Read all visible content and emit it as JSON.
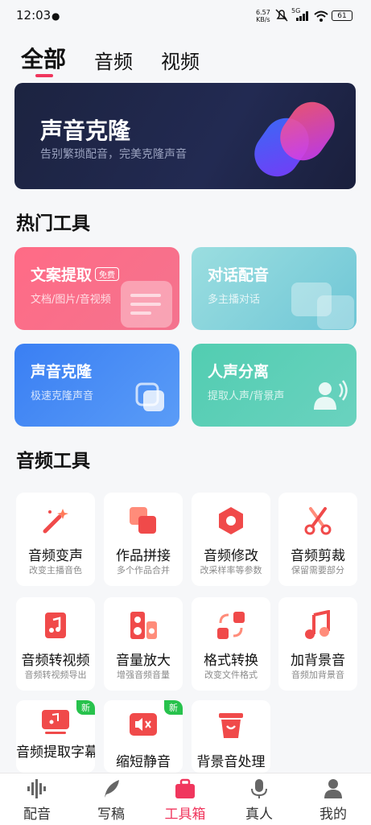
{
  "status_bar": {
    "time": "12:03",
    "net_rate_value": "6.57",
    "net_rate_unit": "KB/s",
    "network": "5G",
    "battery": "61"
  },
  "tabs": [
    {
      "label": "全部",
      "active": true
    },
    {
      "label": "音频",
      "active": false
    },
    {
      "label": "视频",
      "active": false
    }
  ],
  "banner": {
    "title": "声音克隆",
    "subtitle": "告别繁琐配音，完美克隆声音"
  },
  "hot_tools": {
    "title": "热门工具",
    "items": [
      {
        "title": "文案提取",
        "badge": "免费",
        "subtitle": "文档/图片/音视频",
        "color": "#f8607f"
      },
      {
        "title": "对话配音",
        "subtitle": "多主播对话",
        "color": "#7fd3d8"
      },
      {
        "title": "声音克隆",
        "subtitle": "极速克隆声音",
        "color": "#3f86f2"
      },
      {
        "title": "人声分离",
        "subtitle": "提取人声/背景声",
        "color": "#4ec8b0"
      }
    ]
  },
  "audio_tools": {
    "title": "音频工具",
    "items": [
      {
        "label": "音频变声",
        "sub": "改变主播音色",
        "icon": "magic-wand-icon"
      },
      {
        "label": "作品拼接",
        "sub": "多个作品合并",
        "icon": "merge-icon"
      },
      {
        "label": "音频修改",
        "sub": "改采样率等参数",
        "icon": "settings-hex-icon"
      },
      {
        "label": "音频剪裁",
        "sub": "保留需要部分",
        "icon": "scissors-icon"
      },
      {
        "label": "音频转视频",
        "sub": "音频转视频导出",
        "icon": "music-file-icon"
      },
      {
        "label": "音量放大",
        "sub": "增强音频音量",
        "icon": "speaker-icon"
      },
      {
        "label": "格式转换",
        "sub": "改变文件格式",
        "icon": "convert-icon"
      },
      {
        "label": "加背景音",
        "sub": "音频加背景音",
        "icon": "music-note-icon"
      },
      {
        "label": "音频提取字幕",
        "badge": "新",
        "icon": "subtitle-icon"
      },
      {
        "label": "缩短静音",
        "badge": "新",
        "icon": "mute-icon"
      },
      {
        "label": "背景音处理",
        "icon": "bucket-icon"
      }
    ]
  },
  "bottom_nav": [
    {
      "label": "配音",
      "active": false
    },
    {
      "label": "写稿",
      "active": false
    },
    {
      "label": "工具箱",
      "active": true
    },
    {
      "label": "真人",
      "active": false
    },
    {
      "label": "我的",
      "active": false
    }
  ],
  "colors": {
    "accent": "#f0365d",
    "new_badge": "#27c24c"
  }
}
